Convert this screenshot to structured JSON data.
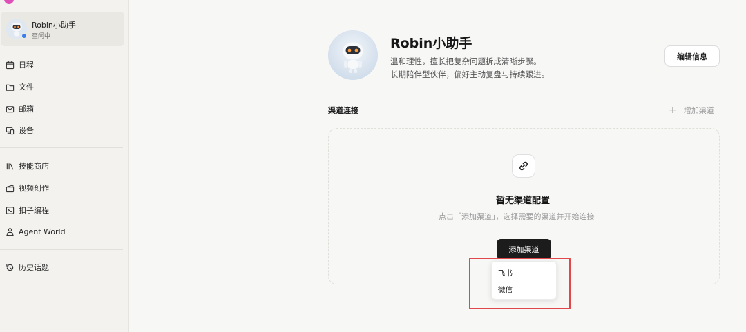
{
  "sidebar": {
    "profile": {
      "name": "Robin小助手",
      "status": "空闲中"
    },
    "items": [
      {
        "label": "日程",
        "icon": "calendar-icon"
      },
      {
        "label": "文件",
        "icon": "folder-icon"
      },
      {
        "label": "邮箱",
        "icon": "mail-icon"
      },
      {
        "label": "设备",
        "icon": "device-icon"
      },
      {
        "label": "技能商店",
        "icon": "library-icon"
      },
      {
        "label": "视频创作",
        "icon": "clapper-icon"
      },
      {
        "label": "扣子编程",
        "icon": "terminal-icon"
      },
      {
        "label": "Agent World",
        "icon": "person-icon"
      },
      {
        "label": "历史话题",
        "icon": "history-icon"
      }
    ]
  },
  "agent": {
    "name": "Robin小助手",
    "desc_line1": "温和理性，擅长把复杂问题拆成清晰步骤。",
    "desc_line2": "长期陪伴型伙伴，偏好主动复盘与持续跟进。",
    "edit_label": "编辑信息"
  },
  "channels": {
    "title": "渠道连接",
    "add_link_label": "增加渠道",
    "empty_title": "暂无渠道配置",
    "empty_desc": "点击「添加渠道」，选择需要的渠道并开始连接",
    "add_button_label": "添加渠道",
    "dropdown_options": [
      "飞书",
      "微信"
    ]
  },
  "colors": {
    "accent_pink": "#e04fb8",
    "status_blue": "#3b7cf0",
    "highlight_red": "#e0484b",
    "primary_button": "#1c1c1c"
  }
}
